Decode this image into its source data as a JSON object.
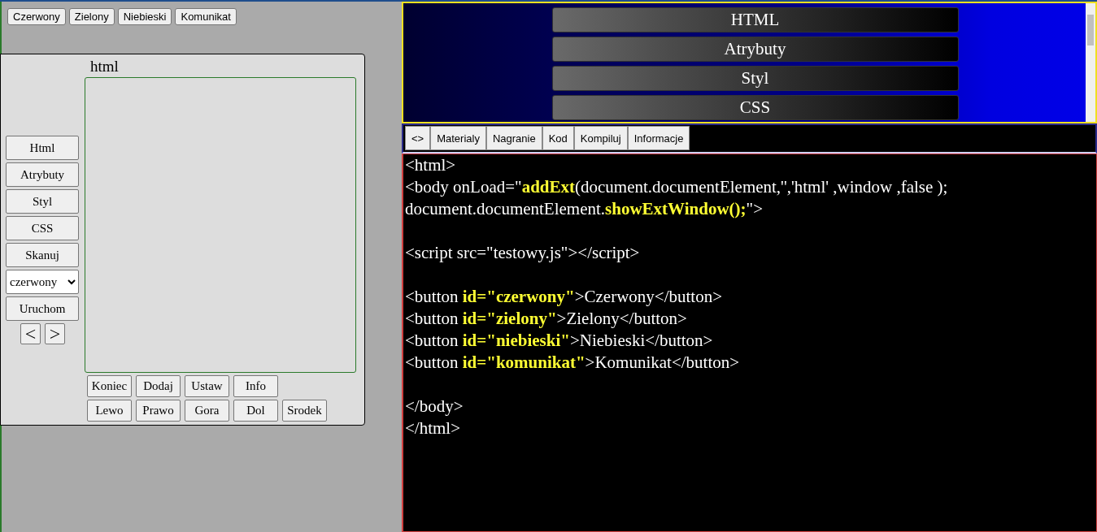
{
  "top_buttons": [
    "Czerwony",
    "Zielony",
    "Niebieski",
    "Komunikat"
  ],
  "editor": {
    "title": "html",
    "side_buttons": [
      "Html",
      "Atrybuty",
      "Styl",
      "CSS",
      "Skanuj"
    ],
    "select": {
      "value": "czerwony"
    },
    "run_button": "Uruchom",
    "nav_buttons": [
      "<",
      ">"
    ],
    "bottom_rows": [
      [
        "Koniec",
        "Dodaj",
        "Ustaw",
        "Info"
      ],
      [
        "Lewo",
        "Prawo",
        "Gora",
        "Dol",
        "Srodek"
      ]
    ]
  },
  "menu": [
    "HTML",
    "Atrybuty",
    "Styl",
    "CSS"
  ],
  "tabs": [
    "<>",
    "Materialy",
    "Nagranie",
    "Kod",
    "Kompiluj",
    "Informacje"
  ],
  "code_blocks": [
    [
      "<html>",
      "<body onLoad=\"**addExt**(document.documentElement,'','html' ,window ,false );",
      "document.documentElement.**showExtWindow();**\">"
    ],
    [
      "<script src=\"testowy.js\"></script>"
    ],
    [
      "<button **id=\"czerwony\"**>Czerwony</button>",
      "<button **id=\"zielony\"**>Zielony</button>",
      "<button **id=\"niebieski\"**>Niebieski</button>",
      "<button **id=\"komunikat\"**>Komunikat</button>"
    ],
    [
      "</body>",
      "</html>"
    ]
  ]
}
